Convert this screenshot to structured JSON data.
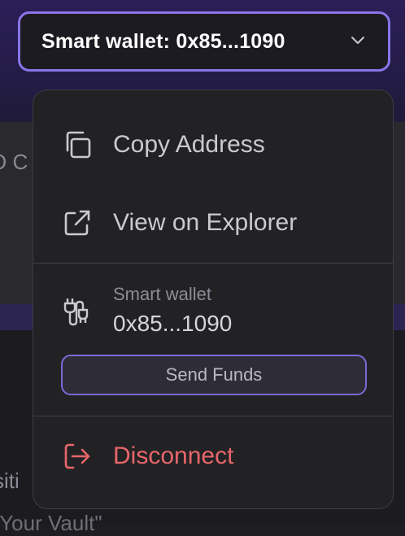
{
  "header": {
    "wallet_button_label": "Smart wallet: 0x85...1090"
  },
  "background": {
    "text_fragment_1": "O C",
    "text_fragment_2": "siti",
    "text_fragment_3": "\"Your Vault\""
  },
  "menu": {
    "copy_address_label": "Copy Address",
    "view_explorer_label": "View on Explorer",
    "smart_wallet_label": "Smart wallet",
    "smart_wallet_address": "0x85...1090",
    "send_funds_label": "Send Funds",
    "disconnect_label": "Disconnect"
  },
  "colors": {
    "accent": "#8a74e8",
    "danger": "#e8666a",
    "menu_bg": "#222224"
  },
  "icons": {
    "copy": "copy-icon",
    "external": "external-link-icon",
    "wallet": "wallet-plug-icon",
    "logout": "logout-icon",
    "chevron": "chevron-down-icon"
  }
}
